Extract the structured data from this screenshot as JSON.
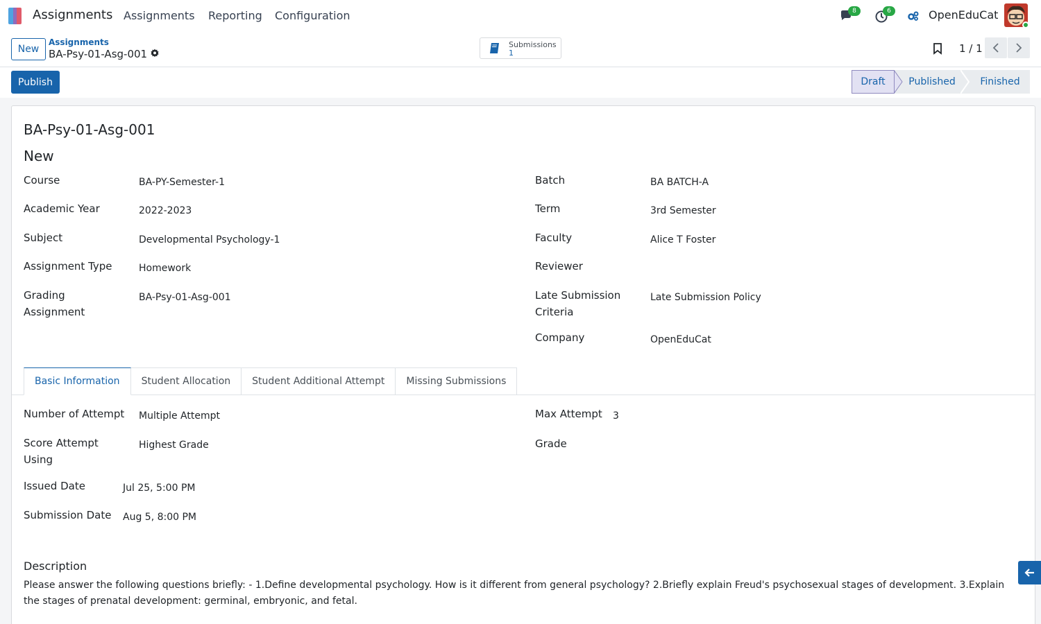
{
  "navbar": {
    "app_name": "Assignments",
    "menu": [
      "Assignments",
      "Reporting",
      "Configuration"
    ],
    "messages_count": "8",
    "activities_count": "6",
    "company": "OpenEduCat"
  },
  "control": {
    "new_label": "New",
    "breadcrumb_parent": "Assignments",
    "breadcrumb_current": "BA-Psy-01-Asg-001",
    "smart_button": {
      "label": "Submissions",
      "value": "1"
    },
    "pager": "1 / 1"
  },
  "statusbar": {
    "publish_label": "Publish",
    "stages": [
      "Draft",
      "Published",
      "Finished"
    ],
    "active_stage": "Draft"
  },
  "form": {
    "title": "BA-Psy-01-Asg-001",
    "state": "New",
    "left_fields": [
      {
        "label": "Course",
        "value": "BA-PY-Semester-1"
      },
      {
        "label": "Academic Year",
        "value": "2022-2023"
      },
      {
        "label": "Subject",
        "value": "Developmental Psychology-1"
      },
      {
        "label": "Assignment Type",
        "value": "Homework"
      },
      {
        "label": "Grading Assignment",
        "value": "BA-Psy-01-Asg-001"
      }
    ],
    "right_fields": [
      {
        "label": "Batch",
        "value": "BA BATCH-A"
      },
      {
        "label": "Term",
        "value": "3rd Semester"
      },
      {
        "label": "Faculty",
        "value": "Alice T Foster"
      },
      {
        "label": "Reviewer",
        "value": ""
      },
      {
        "label": "Late Submission Criteria",
        "value": "Late Submission Policy"
      },
      {
        "label": "Company",
        "value": "OpenEduCat"
      }
    ],
    "tabs": [
      "Basic Information",
      "Student Allocation",
      "Student Additional Attempt",
      "Missing Submissions"
    ],
    "active_tab": "Basic Information",
    "basic_left": [
      {
        "label": "Number of Attempt",
        "value": "Multiple Attempt"
      },
      {
        "label": "Score Attempt Using",
        "value": "Highest Grade"
      },
      {
        "label": "Issued Date",
        "value": "Jul 25, 5:00 PM"
      },
      {
        "label": "Submission Date",
        "value": "Aug 5, 8:00 PM"
      }
    ],
    "basic_right": [
      {
        "label": "Max Attempt",
        "value": "3"
      },
      {
        "label": "Grade",
        "value": ""
      }
    ],
    "description_label": "Description",
    "description": "Please answer the following questions briefly: - 1.Define developmental psychology. How is it different from general psychology? 2.Briefly explain Freud's psychosexual stages of development. 3.Explain the stages of prenatal development: germinal, embryonic, and fetal."
  },
  "colors": {
    "primary": "#1864ab",
    "badge": "#28a745",
    "stage_active_bg": "#e2e1f3"
  }
}
